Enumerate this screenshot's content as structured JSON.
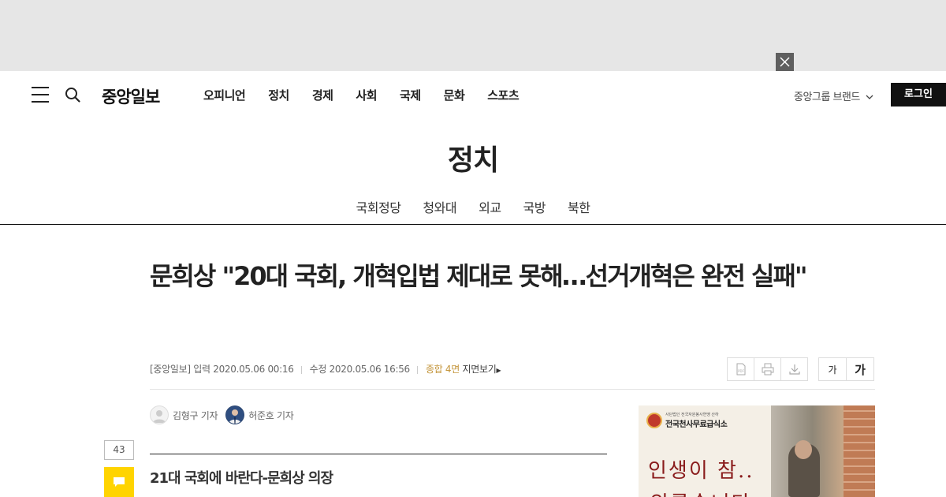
{
  "ad_top": {
    "close_icon": "close-icon"
  },
  "header": {
    "logo": "중앙일보",
    "nav": [
      "오피니언",
      "정치",
      "경제",
      "사회",
      "국제",
      "문화",
      "스포츠"
    ],
    "brand_label": "중앙그룹 브랜드",
    "login_label": "로그인"
  },
  "section": {
    "title": "정치",
    "subnav": [
      "국회정당",
      "청와대",
      "외교",
      "국방",
      "북한"
    ]
  },
  "article": {
    "headline": "문희상 \"20대 국회, 개혁입법 제대로 못해…선거개혁은 완전 실패\"",
    "source": "[중앙일보]",
    "published": "입력 2020.05.06 00:16",
    "modified": "수정 2020.05.06 16:56",
    "page": "종합 4면",
    "page_view_link": "지면보기",
    "reporters": [
      "김형구 기자",
      "허준호 기자"
    ],
    "comment_count": "43",
    "subhead": "21대 국회에 바란다-문희상 의장"
  },
  "tools": {
    "pdf_label": "PDF",
    "font_small": "가",
    "font_large": "가"
  },
  "side_ad": {
    "org_small": "사단법인 전국자원봉사연맹 산하",
    "org_name": "전국천사무료급식소",
    "slogan": "인생이 참..",
    "slogan2": "외롭습니다"
  },
  "colors": {
    "accent_page": "#c4963c",
    "comment_button": "#ffd400",
    "login_button": "#111111"
  }
}
